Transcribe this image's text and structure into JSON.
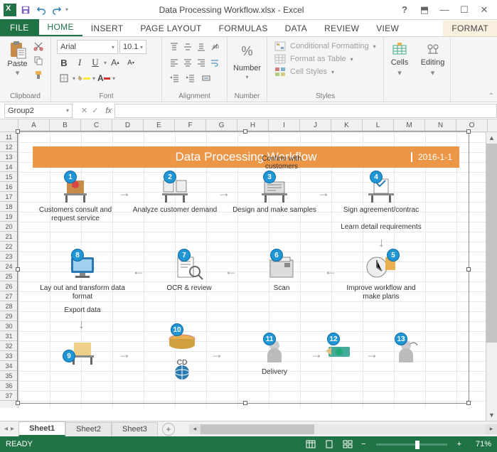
{
  "titlebar": {
    "title": "Data Processing Workflow.xlsx - Excel"
  },
  "tabs": {
    "file": "FILE",
    "home": "HOME",
    "insert": "INSERT",
    "page_layout": "PAGE LAYOUT",
    "formulas": "FORMULAS",
    "data": "DATA",
    "review": "REVIEW",
    "view": "VIEW",
    "format": "FORMAT"
  },
  "ribbon": {
    "clipboard": {
      "paste": "Paste",
      "label": "Clipboard"
    },
    "font": {
      "name": "Arial",
      "size": "10.1",
      "label": "Font"
    },
    "alignment": {
      "label": "Alignment"
    },
    "number": {
      "label": "Number",
      "btn": "Number"
    },
    "styles": {
      "cond": "Conditional Formatting",
      "table": "Format as Table",
      "cell": "Cell Styles",
      "label": "Styles"
    },
    "cells": {
      "btn": "Cells"
    },
    "editing": {
      "btn": "Editing"
    }
  },
  "formula_bar": {
    "name_box": "Group2"
  },
  "columns": [
    "A",
    "B",
    "C",
    "D",
    "E",
    "F",
    "G",
    "H",
    "I",
    "J",
    "K",
    "L",
    "M",
    "N",
    "O"
  ],
  "rows": [
    11,
    12,
    13,
    14,
    15,
    16,
    17,
    18,
    19,
    20,
    21,
    22,
    23,
    24,
    25,
    26,
    27,
    28,
    29,
    30,
    31,
    32,
    33,
    34,
    35,
    36,
    37
  ],
  "diagram": {
    "title": "Data Processing Workflow",
    "date": "2016-1-1",
    "steps": {
      "1": "Customers consult and request service",
      "2": "Analyze customer demand",
      "3": "Design and make samples",
      "3a": "Confirm with customers",
      "4": "Sign agreement/contrac",
      "4a": "Learn detail requirements",
      "5": "Improve workflow and make plans",
      "6": "Scan",
      "7": "OCR & review",
      "8": "Lay out and transform data  format",
      "8a": "Export data",
      "10": "CD",
      "11": "Delivery"
    }
  },
  "sheets": {
    "s1": "Sheet1",
    "s2": "Sheet2",
    "s3": "Sheet3"
  },
  "status": {
    "ready": "READY",
    "zoom": "71%"
  }
}
